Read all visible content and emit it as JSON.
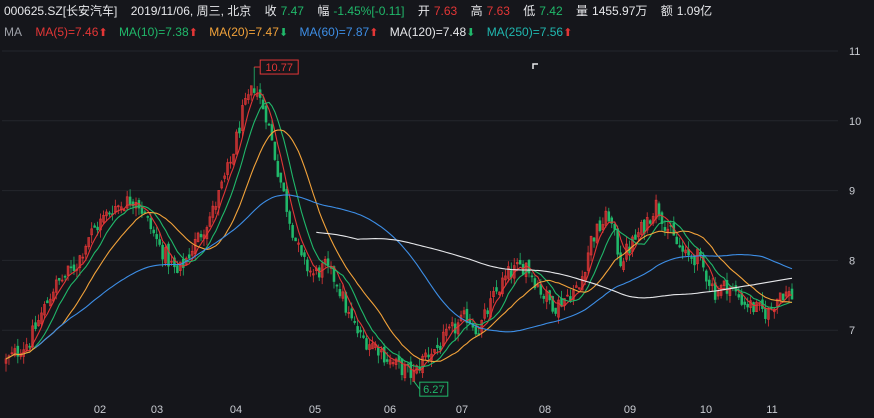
{
  "header": {
    "symbol": "000625.SZ[长安汽车]",
    "datetime": "2019/11/06, 周三, 北京",
    "close_label": "收",
    "close": "7.47",
    "change_label": "幅",
    "change_pct": "-1.45%",
    "change_abs": "[-0.11]",
    "open_label": "开",
    "open": "7.63",
    "high_label": "高",
    "high": "7.63",
    "low_label": "低",
    "low": "7.42",
    "volume_label": "量",
    "volume": "1455.97万",
    "amount_label": "额",
    "amount": "1.09亿"
  },
  "ma_bar": {
    "label": "MA",
    "items": [
      {
        "text": "MA(5)=7.46",
        "color": "#e23636",
        "dir": "up"
      },
      {
        "text": "MA(10)=7.38",
        "color": "#20b86a",
        "dir": "up"
      },
      {
        "text": "MA(20)=7.47",
        "color": "#f2a23a",
        "dir": "down"
      },
      {
        "text": "MA(60)=7.87",
        "color": "#3d8ee6",
        "dir": "up"
      },
      {
        "text": "MA(120)=7.48",
        "color": "#e6e7ea",
        "dir": "down"
      },
      {
        "text": "MA(250)=7.56",
        "color": "#20b8b0",
        "dir": "up"
      }
    ]
  },
  "colors": {
    "up": "#e23636",
    "down": "#20b86a",
    "ma5": "#e23636",
    "ma10": "#20b86a",
    "ma20": "#f2a23a",
    "ma60": "#3d8ee6",
    "ma120": "#e6e7ea",
    "ma250": "#20b8b0"
  },
  "chart_data": {
    "type": "candlestick",
    "x_ticks": [
      "02",
      "03",
      "04",
      "05",
      "06",
      "07",
      "08",
      "09",
      "10",
      "11"
    ],
    "y_ticks": [
      7,
      8,
      9,
      10,
      11
    ],
    "ylim": [
      6.0,
      11.1
    ],
    "annotations": [
      {
        "text": "10.77",
        "type": "max",
        "value": 10.77
      },
      {
        "text": "6.27",
        "type": "min",
        "value": 6.27
      }
    ],
    "price_anchors": [
      [
        0,
        6.55
      ],
      [
        8,
        6.85
      ],
      [
        16,
        7.6
      ],
      [
        24,
        7.95
      ],
      [
        28,
        8.35
      ],
      [
        36,
        8.75
      ],
      [
        44,
        8.9
      ],
      [
        52,
        8.2
      ],
      [
        58,
        7.8
      ],
      [
        64,
        8.25
      ],
      [
        70,
        8.7
      ],
      [
        76,
        9.4
      ],
      [
        80,
        10.1
      ],
      [
        84,
        10.5
      ],
      [
        88,
        10.1
      ],
      [
        92,
        9.3
      ],
      [
        96,
        8.6
      ],
      [
        100,
        8.0
      ],
      [
        104,
        7.8
      ],
      [
        108,
        7.9
      ],
      [
        112,
        7.7
      ],
      [
        116,
        7.2
      ],
      [
        120,
        6.9
      ],
      [
        126,
        6.75
      ],
      [
        130,
        6.55
      ],
      [
        134,
        6.45
      ],
      [
        138,
        6.35
      ],
      [
        142,
        6.65
      ],
      [
        146,
        6.75
      ],
      [
        150,
        6.95
      ],
      [
        156,
        7.2
      ],
      [
        160,
        7.0
      ],
      [
        166,
        7.55
      ],
      [
        170,
        7.8
      ],
      [
        176,
        7.95
      ],
      [
        182,
        7.5
      ],
      [
        186,
        7.35
      ],
      [
        190,
        7.5
      ],
      [
        194,
        7.6
      ],
      [
        198,
        8.3
      ],
      [
        204,
        8.65
      ],
      [
        208,
        8.0
      ],
      [
        212,
        8.25
      ],
      [
        216,
        8.5
      ],
      [
        220,
        8.8
      ],
      [
        226,
        8.3
      ],
      [
        230,
        8.05
      ],
      [
        234,
        8.05
      ],
      [
        240,
        7.55
      ],
      [
        244,
        7.65
      ],
      [
        250,
        7.4
      ],
      [
        254,
        7.3
      ],
      [
        258,
        7.25
      ],
      [
        262,
        7.55
      ],
      [
        266,
        7.5
      ]
    ],
    "candle_count": 267
  }
}
